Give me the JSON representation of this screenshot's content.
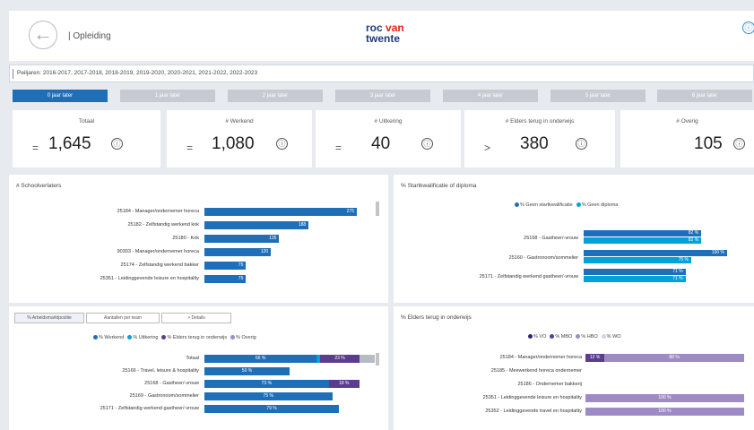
{
  "header": {
    "title": "| Opleiding",
    "logo_line1": "roc ",
    "logo_line1_accent": "van",
    "logo_line2": "twente",
    "back_icon": "back-arrow-icon",
    "info_icon": "info-icon",
    "info_glyph": "ⓘ"
  },
  "filter": {
    "text": "Peiljaren: 2016-2017, 2017-2018, 2018-2019, 2019-2020, 2020-2021, 2021-2022, 2022-2023"
  },
  "tabs": [
    {
      "label": "0 jaar later",
      "active": true
    },
    {
      "label": "1 jaar later",
      "active": false
    },
    {
      "label": "2 jaar later",
      "active": false
    },
    {
      "label": "3 jaar later",
      "active": false
    },
    {
      "label": "4 jaar later",
      "active": false
    },
    {
      "label": "5 jaar later",
      "active": false
    },
    {
      "label": "6 jaar later",
      "active": false
    }
  ],
  "kpis": [
    {
      "label": "Totaal",
      "symbol": "=",
      "value": "1,645",
      "info": "ⓘ"
    },
    {
      "label": "# Werkend",
      "symbol": "=",
      "value": "1,080",
      "info": "ⓘ"
    },
    {
      "label": "# Uitkering",
      "symbol": "=",
      "value": "40",
      "info": "ⓘ"
    },
    {
      "label": "# Elders terug in onderwijs",
      "symbol": ">",
      "value": "380",
      "info": "ⓘ"
    },
    {
      "label": "# Overig",
      "symbol": "",
      "value": "105",
      "info": "ⓘ"
    }
  ],
  "colors": {
    "blue": "#1f6fb8",
    "cyan": "#00a2d9",
    "purple": "#5b3d8f",
    "lavender": "#9e8bc6",
    "gray": "#b7bcc2"
  },
  "panel_schoolverlaters": {
    "title": "# Schoolverlaters",
    "rows": [
      {
        "label": "25184 - Manager/ondernemer horeca",
        "value": 275,
        "text": "275"
      },
      {
        "label": "25182 - Zelfstandig werkend kok",
        "value": 188,
        "text": "188"
      },
      {
        "label": "25180 - Kok",
        "value": 135,
        "text": "135"
      },
      {
        "label": "90303 - Manager/ondernemer horeca",
        "value": 120,
        "text": "120"
      },
      {
        "label": "25174 - Zelfstandig werkend bakker",
        "value": 75,
        "text": "75"
      },
      {
        "label": "25351 - Leidinggevende leisure en hospitality",
        "value": 75,
        "text": "75"
      }
    ],
    "max": 275
  },
  "panel_startkwalificatie": {
    "title": "% Startkwalificatie of diploma",
    "legend": [
      {
        "label": "% Geen startkwalificatie",
        "color": "#1f6fb8"
      },
      {
        "label": "% Geen diploma",
        "color": "#00a2d9"
      }
    ],
    "rows": [
      {
        "label": "25168 - Gastheer/-vrouw",
        "values": [
          82,
          82
        ],
        "texts": [
          "82 %",
          "82 %"
        ]
      },
      {
        "label": "25160 - Gastronoom/sommelier",
        "values": [
          100,
          75
        ],
        "texts": [
          "100 %",
          "75 %"
        ]
      },
      {
        "label": "25171 - Zelfstandig werkend gastheer/-vrouw",
        "values": [
          71,
          71
        ],
        "texts": [
          "71 %",
          "71 %"
        ]
      }
    ]
  },
  "panel_arbeidsmarkt": {
    "subtabs": [
      "% Arbeidsmarktpositie",
      "Aantallen per team",
      "> Details"
    ],
    "legend": [
      {
        "label": "% Werkend",
        "color": "#1f6fb8"
      },
      {
        "label": "% Uitkering",
        "color": "#00a2d9"
      },
      {
        "label": "% Elders terug in onderwijs",
        "color": "#5b3d8f"
      },
      {
        "label": "% Overig",
        "color": "#9e8bc6"
      }
    ],
    "rows": [
      {
        "label": "Totaal",
        "segments": [
          66,
          2,
          23,
          9
        ],
        "texts": [
          "66 %",
          "",
          "23 %",
          ""
        ]
      },
      {
        "label": "25166 - Travel, leisure & hospitality",
        "segments": [
          50,
          0,
          0,
          0
        ],
        "texts": [
          "50 %",
          "",
          "",
          ""
        ]
      },
      {
        "label": "25168 - Gastheer/-vrouw",
        "segments": [
          73,
          0,
          18,
          0
        ],
        "texts": [
          "73 %",
          "",
          "18 %",
          ""
        ]
      },
      {
        "label": "25169 - Gastronoom/sommelier",
        "segments": [
          75,
          0,
          0,
          0
        ],
        "texts": [
          "75 %",
          "",
          "",
          ""
        ]
      },
      {
        "label": "25171 - Zelfstandig werkend gastheer/-vrouw",
        "segments": [
          79,
          0,
          0,
          0
        ],
        "texts": [
          "79 %",
          "",
          "",
          ""
        ]
      }
    ]
  },
  "panel_elders": {
    "title": "% Elders terug in onderwijs",
    "legend": [
      {
        "label": "% VO",
        "color": "#2b2b6b"
      },
      {
        "label": "% MBO",
        "color": "#5b3d8f"
      },
      {
        "label": "% HBO",
        "color": "#9e8bc6"
      },
      {
        "label": "% WO",
        "color": "#d8d0ea"
      }
    ],
    "rows": [
      {
        "label": "25184 - Manager/ondernemer horeca",
        "segments": [
          12,
          88
        ],
        "texts": [
          "12 %",
          "88 %"
        ]
      },
      {
        "label": "25185 - Meewerkend horeca ondernemer",
        "segments": [
          0,
          0
        ],
        "texts": [
          "",
          ""
        ]
      },
      {
        "label": "25186 - Ondernemer bakkerij",
        "segments": [
          0,
          0
        ],
        "texts": [
          "",
          ""
        ]
      },
      {
        "label": "25351 - Leidinggevende leisure en hospitality",
        "segments": [
          0,
          100
        ],
        "texts": [
          "",
          "100 %"
        ]
      },
      {
        "label": "25352 - Leidinggevende travel en hospitality",
        "segments": [
          0,
          100
        ],
        "texts": [
          "",
          "100 %"
        ]
      }
    ]
  }
}
